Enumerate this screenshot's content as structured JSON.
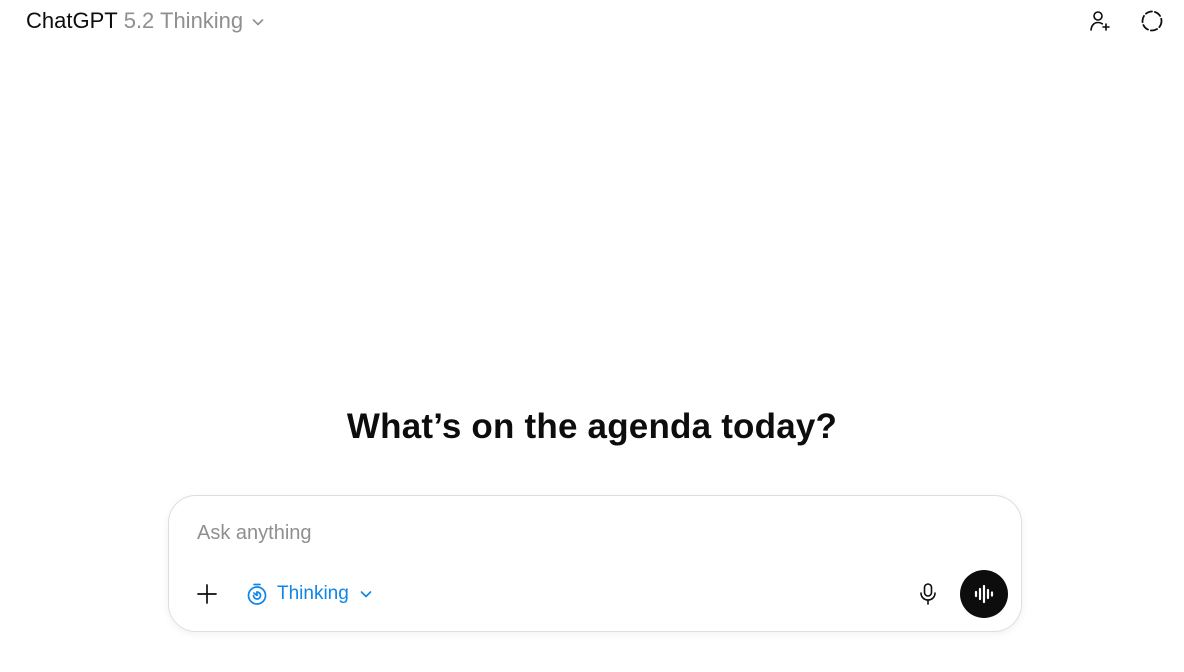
{
  "header": {
    "model_name": "ChatGPT",
    "model_variant": "5.2 Thinking",
    "chevron_icon": "chevron-down-icon",
    "add_people_icon": "add-person-icon",
    "temporary_chat_icon": "dashed-circle-icon"
  },
  "main": {
    "headline": "What’s on the agenda today?"
  },
  "composer": {
    "placeholder": "Ask anything",
    "value": "",
    "attach_icon": "plus-icon",
    "mode_icon": "timer-icon",
    "mode_label": "Thinking",
    "mode_chevron_icon": "chevron-down-icon",
    "mic_icon": "microphone-icon",
    "voice_icon": "voice-waveform-icon"
  },
  "colors": {
    "accent_blue": "#0d86e8",
    "text_primary": "#0d0d0d",
    "text_muted": "#8f8f8f",
    "composer_border": "#dedede",
    "voice_button_bg": "#0d0d0d"
  }
}
